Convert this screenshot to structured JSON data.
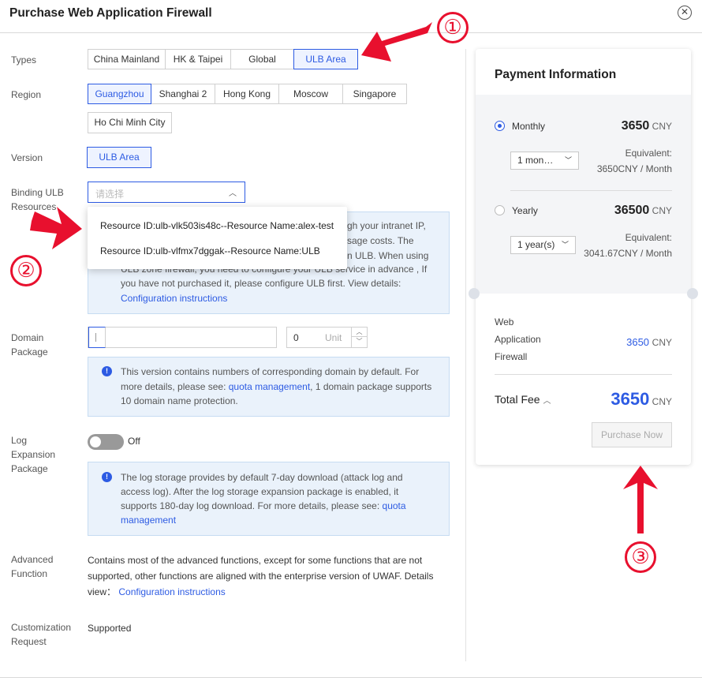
{
  "dialog": {
    "title": "Purchase Web Application Firewall"
  },
  "form": {
    "types": {
      "label": "Types",
      "options": [
        "China Mainland",
        "HK & Taipei",
        "Global",
        "ULB Area"
      ],
      "selected": "ULB Area"
    },
    "region": {
      "label": "Region",
      "options_row1": [
        "Guangzhou",
        "Shanghai 2",
        "Hong Kong",
        "Moscow",
        "Singapore"
      ],
      "options_row2": [
        "Ho Chi Minh City"
      ],
      "selected": "Guangzhou"
    },
    "version": {
      "label": "Version",
      "value": "ULB Area"
    },
    "binding": {
      "label_line1": "Binding ULB",
      "label_line2": "Resources",
      "placeholder": "请选择",
      "dropdown": [
        "Resource ID:ulb-vlk503is48c--Resource Name:alex-test",
        "Resource ID:ulb-vlfmx7dggak--Resource Name:ULB"
      ],
      "info_visible": [
        "gh your intranet IP,",
        "sage costs. The",
        "n ULB. When using",
        "ULB zone firewall, you need to configure your ULB service in advance , If",
        "you have not purchased it, please configure ULB first. View details:"
      ],
      "info_link": "Configuration instructions"
    },
    "domain_package": {
      "label_line1": "Domain",
      "label_line2": "Package",
      "count": "0",
      "unit": "Unit",
      "info_line1": "This version contains numbers of corresponding domain by default. For",
      "info_line2_pre": "more details, please see: ",
      "info_line2_link": "quota management",
      "info_line2_post": ", 1 domain package supports",
      "info_line3": "10 domain name protection."
    },
    "log_expansion": {
      "label_line1": "Log",
      "label_line2": "Expansion",
      "label_line3": "Package",
      "toggle_state": "Off",
      "info_line1": "The log storage provides by default 7-day download (attack log and",
      "info_line2": "access log). After the log storage expansion package is enabled, it",
      "info_line3_pre": "supports 180-day log download. For more details, please see: ",
      "info_line3_link": "quota",
      "info_line4_link": "management"
    },
    "advanced": {
      "label_line1": "Advanced",
      "label_line2": "Function",
      "line1": "Contains most of the advanced functions, except for some functions that are not",
      "line2": "supported, other functions are aligned with the enterprise version of UWAF. Details",
      "line3_pre": "view：",
      "line3_link": "Configuration instructions"
    },
    "customization": {
      "label_line1": "Customization",
      "label_line2": "Request",
      "value": "Supported"
    }
  },
  "payment": {
    "title": "Payment Information",
    "monthly": {
      "label": "Monthly",
      "price": "3650",
      "currency": "CNY",
      "duration": "1 mon…",
      "equiv_label": "Equivalent:",
      "equiv_value": "3650CNY / Month",
      "selected": true
    },
    "yearly": {
      "label": "Yearly",
      "price": "36500",
      "currency": "CNY",
      "duration": "1 year(s)",
      "equiv_label": "Equivalent:",
      "equiv_value": "3041.67CNY / Month",
      "selected": false
    },
    "item": {
      "name_line1": "Web",
      "name_line2": "Application",
      "name_line3": "Firewall",
      "price": "3650",
      "currency": "CNY"
    },
    "total": {
      "label": "Total Fee",
      "price": "3650",
      "currency": "CNY"
    },
    "purchase_button": "Purchase Now"
  },
  "annotations": {
    "marker1": "①",
    "marker2": "②",
    "marker3": "③",
    "color": "#e8102e"
  },
  "colors": {
    "accent": "#2d5be3",
    "info_bg": "#eaf2fb",
    "annotation_red": "#e8102e"
  }
}
